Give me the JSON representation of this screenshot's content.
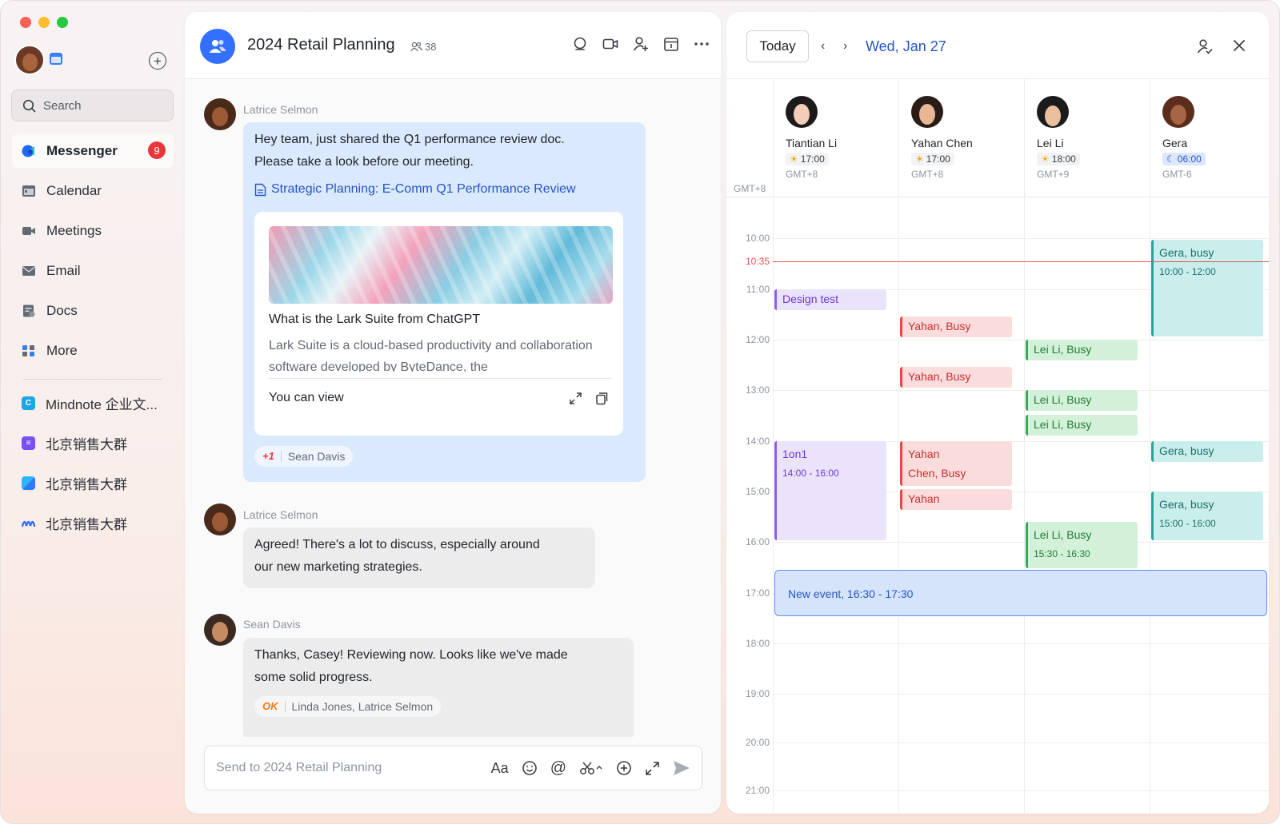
{
  "sidebar": {
    "search_label": "Search",
    "nav": [
      {
        "label": "Messenger",
        "icon": "messenger-icon",
        "badge": "9",
        "active": true
      },
      {
        "label": "Calendar",
        "icon": "calendar-icon"
      },
      {
        "label": "Meetings",
        "icon": "video-icon"
      },
      {
        "label": "Email",
        "icon": "mail-icon"
      },
      {
        "label": "Docs",
        "icon": "docs-icon"
      },
      {
        "label": "More",
        "icon": "grid-icon"
      }
    ],
    "groups": [
      {
        "label": "Mindnote 企业文...",
        "color": "#1fa6e8"
      },
      {
        "label": "北京销售大群",
        "color": "#7a4ff0"
      },
      {
        "label": "北京销售大群",
        "color": "#2f7df6"
      },
      {
        "label": "北京销售大群",
        "color": "#3a6ff3"
      }
    ]
  },
  "chat": {
    "title": "2024 Retail Planning",
    "member_count": "38",
    "messages": [
      {
        "sender": "Latrice Selmon",
        "text_line1": "Hey team, just shared the Q1 performance review doc.",
        "text_line2": "Please take a look before our meeting.",
        "doc_link": "Strategic Planning: E-Comm Q1 Performance Review",
        "card": {
          "title": "What is the Lark Suite from ChatGPT",
          "description": "Lark Suite is a cloud-based productivity and collaboration software developed by ByteDance, the",
          "footer": "You can view"
        },
        "reaction": {
          "emoji": "+1",
          "users": "Sean Davis"
        }
      },
      {
        "sender": "Latrice Selmon",
        "text_line1": "Agreed! There's a lot to discuss, especially around",
        "text_line2": "our new marketing strategies."
      },
      {
        "sender": "Sean Davis",
        "text_line1": "Thanks, Casey! Reviewing now. Looks like we've made",
        "text_line2": "some solid progress.",
        "reaction": {
          "emoji": "OK",
          "users": "Linda Jones, Latrice Selmon"
        }
      }
    ],
    "input_placeholder": "Send to 2024 Retail Planning"
  },
  "calendar": {
    "today_label": "Today",
    "date": "Wed, Jan 27",
    "local_tz": "GMT+8",
    "people": [
      {
        "name": "Tiantian Li",
        "time": "17:00",
        "gmt": "GMT+8",
        "period": "day"
      },
      {
        "name": "Yahan Chen",
        "time": "17:00",
        "gmt": "GMT+8",
        "period": "day"
      },
      {
        "name": "Lei Li",
        "time": "18:00",
        "gmt": "GMT+9",
        "period": "day"
      },
      {
        "name": "Gera",
        "time": "06:00",
        "gmt": "GMT-6",
        "period": "night"
      }
    ],
    "hours": [
      "10:00",
      "11:00",
      "12:00",
      "13:00",
      "14:00",
      "15:00",
      "16:00",
      "17:00",
      "18:00",
      "19:00",
      "20:00",
      "21:00"
    ],
    "now": "10:35",
    "events": {
      "gera_busy_1": "Gera, busy",
      "gera_busy_1_time": "10:00 - 12:00",
      "design_test": "Design test",
      "yahan_busy_1": "Yahan, Busy",
      "lei_busy_1": "Lei Li, Busy",
      "yahan_busy_2": "Yahan, Busy",
      "lei_busy_2": "Lei Li, Busy",
      "lei_busy_3": "Lei Li, Busy",
      "oneonone": "1on1",
      "oneonone_time": "14:00 - 16:00",
      "yahan_chen_busy_a": "Yahan",
      "yahan_chen_busy_b": "Chen, Busy",
      "yahan_3": "Yahan",
      "gera_busy_2": "Gera, busy",
      "gera_busy_3": "Gera, busy",
      "gera_busy_3_time": "15:00 - 16:00",
      "lei_busy_4": "Lei Li, Busy",
      "lei_busy_4_time": "15:30 - 16:30",
      "new_event": "New event, 16:30 - 17:30"
    }
  }
}
